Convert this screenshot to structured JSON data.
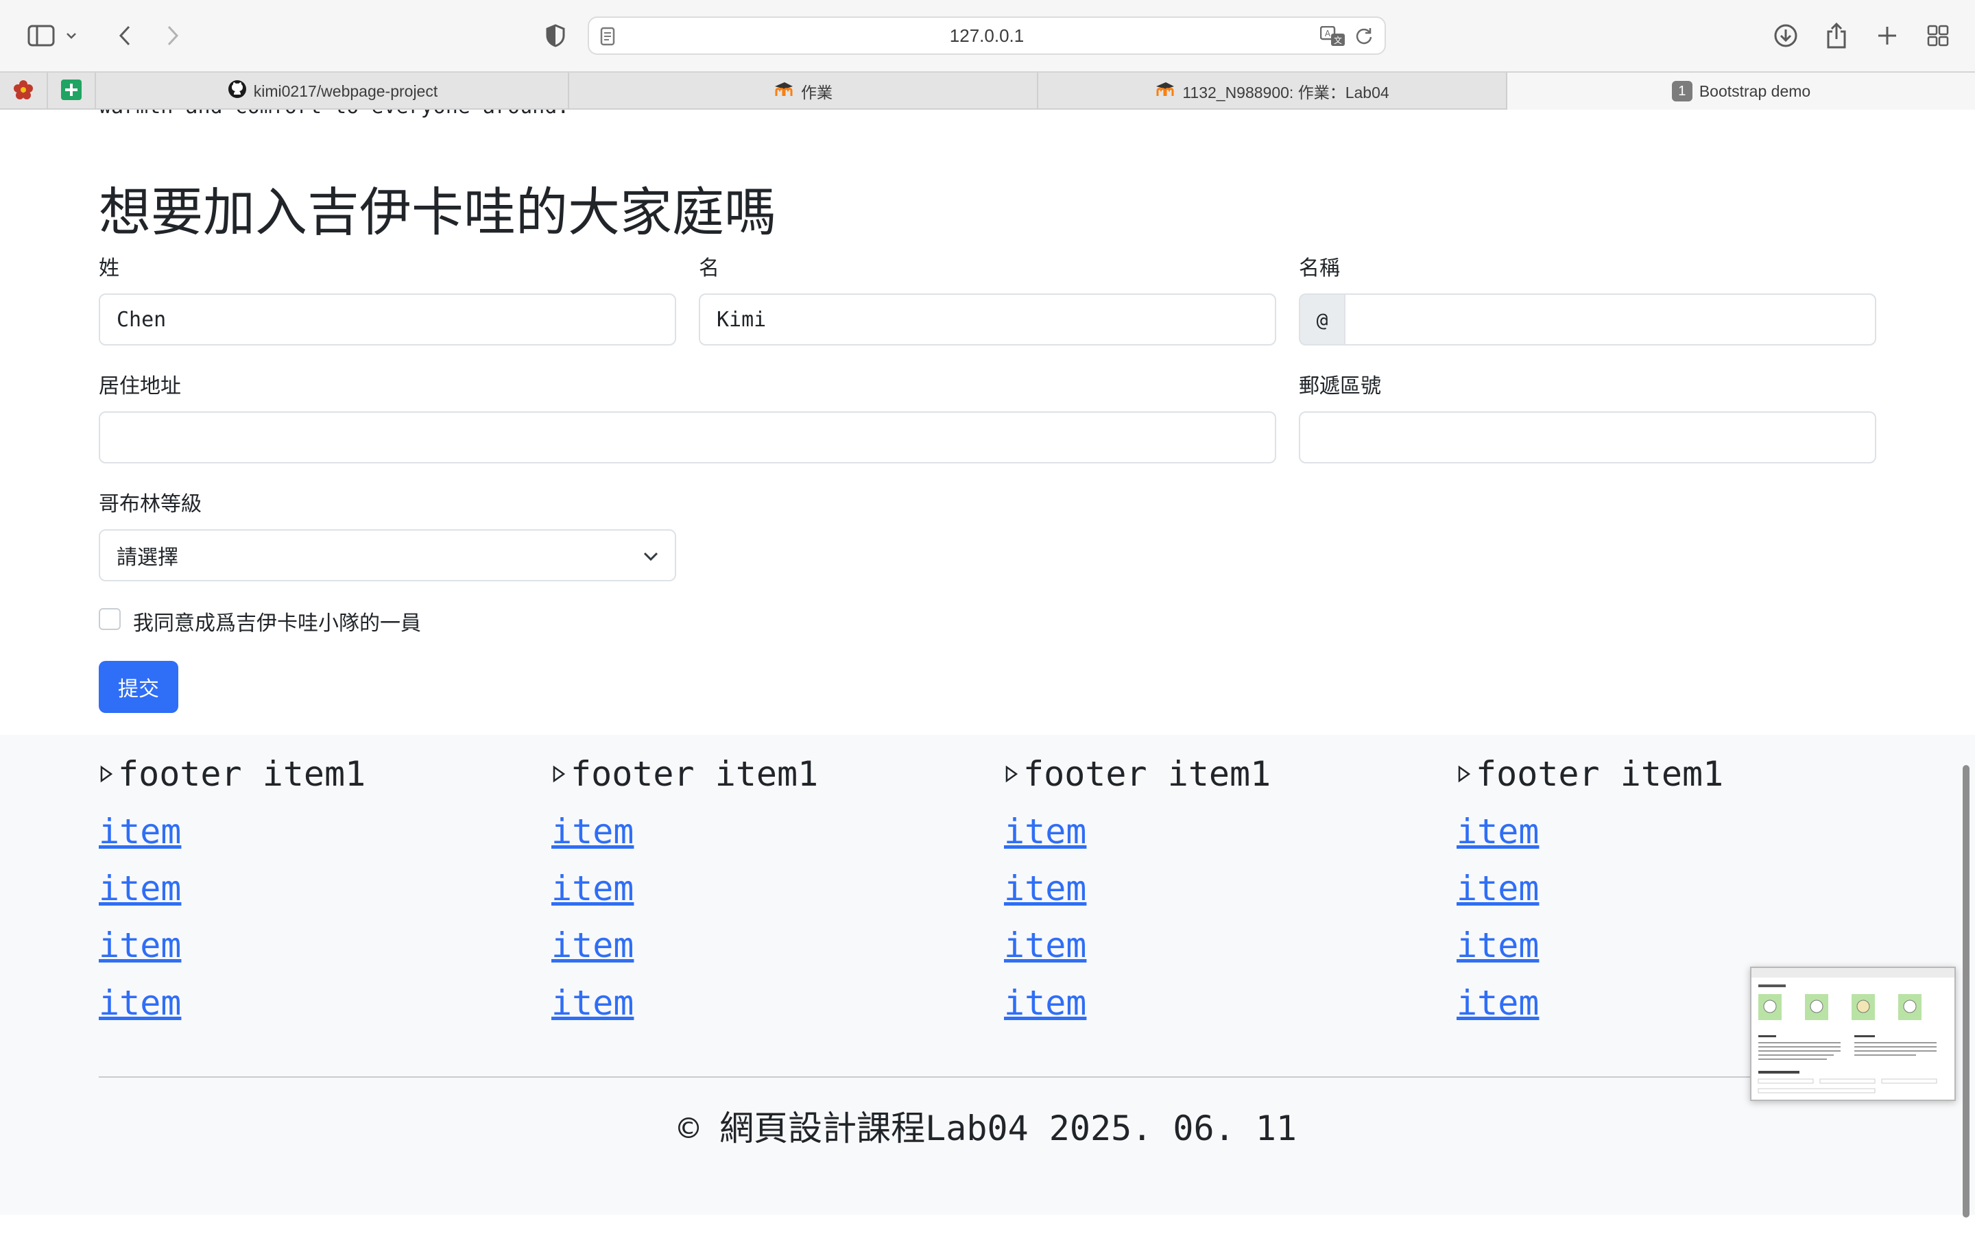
{
  "browser": {
    "url": "127.0.0.1",
    "tabs": [
      {
        "label": "kimi0217/webpage-project",
        "icon": "github-icon"
      },
      {
        "label": "作業",
        "icon": "moodle-icon"
      },
      {
        "label": "1132_N988900: 作業：Lab04",
        "icon": "moodle-icon"
      },
      {
        "label": "Bootstrap demo",
        "badge": "1",
        "active": true
      }
    ]
  },
  "page": {
    "cut_text": "warmth and comfort to everyone around.",
    "heading": "想要加入吉伊卡哇的大家庭嗎",
    "form": {
      "last_name_label": "姓",
      "last_name_value": "Chen",
      "first_name_label": "名",
      "first_name_value": "Kimi",
      "nickname_label": "名稱",
      "nickname_prefix": "@",
      "nickname_value": "",
      "address_label": "居住地址",
      "address_value": "",
      "zip_label": "郵遞區號",
      "zip_value": "",
      "level_label": "哥布林等級",
      "level_selected": "請選擇",
      "agree_label": "我同意成爲吉伊卡哇小隊的一員",
      "agree_checked": false,
      "submit_label": "提交"
    }
  },
  "footer": {
    "columns": [
      {
        "heading": "footer item1",
        "links": [
          "item",
          "item",
          "item",
          "item"
        ]
      },
      {
        "heading": "footer item1",
        "links": [
          "item",
          "item",
          "item",
          "item"
        ]
      },
      {
        "heading": "footer item1",
        "links": [
          "item",
          "item",
          "item",
          "item"
        ]
      },
      {
        "heading": "footer item1",
        "links": [
          "item",
          "item",
          "item",
          "item"
        ]
      }
    ],
    "copyright": "© 網頁設計課程Lab04 2025. 06. 11"
  },
  "colors": {
    "primary": "#2f6ef6",
    "footer_bg": "#f8f9fa"
  }
}
